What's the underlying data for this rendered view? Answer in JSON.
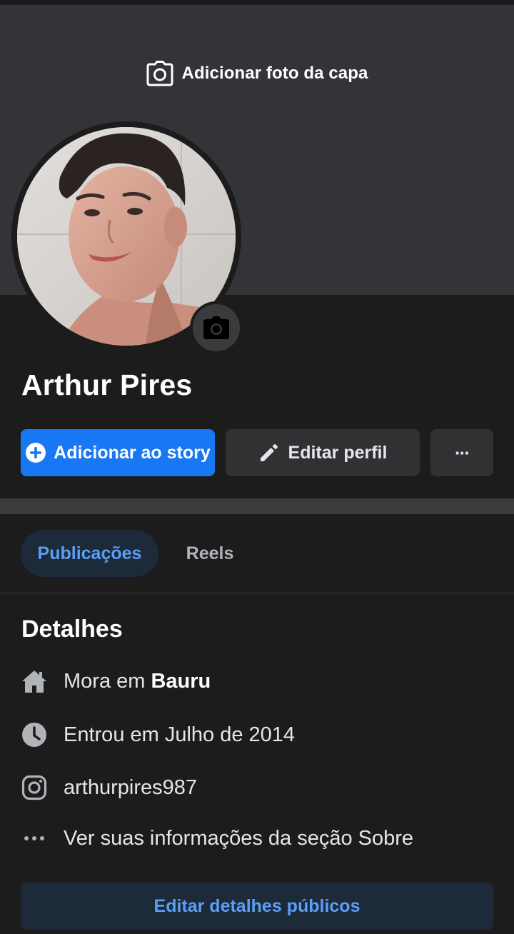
{
  "cover": {
    "add_cover_label": "Adicionar foto da capa"
  },
  "profile": {
    "name": "Arthur Pires"
  },
  "actions": {
    "add_story_label": "Adicionar ao story",
    "edit_profile_label": "Editar perfil",
    "more_label": "···"
  },
  "tabs": [
    {
      "label": "Publicações",
      "selected": true
    },
    {
      "label": "Reels",
      "selected": false
    }
  ],
  "details": {
    "title": "Detalhes",
    "lives_prefix": "Mora em ",
    "lives_city": "Bauru",
    "joined": "Entrou em Julho de 2014",
    "instagram": "arthurpires987",
    "about": "Ver suas informações da seção Sobre",
    "edit_public_label": "Editar detalhes públicos"
  },
  "colors": {
    "background": "#1c1c1d",
    "cover": "#333437",
    "primary": "#1877f2",
    "secondary_button": "#303133",
    "tab_selected_bg": "#1d2a3a",
    "tab_selected_text": "#5b9ef5"
  },
  "icons": [
    "camera-icon",
    "plus-circle-icon",
    "pencil-icon",
    "more-dots-icon",
    "home-icon",
    "clock-icon",
    "instagram-icon",
    "dots-icon"
  ]
}
